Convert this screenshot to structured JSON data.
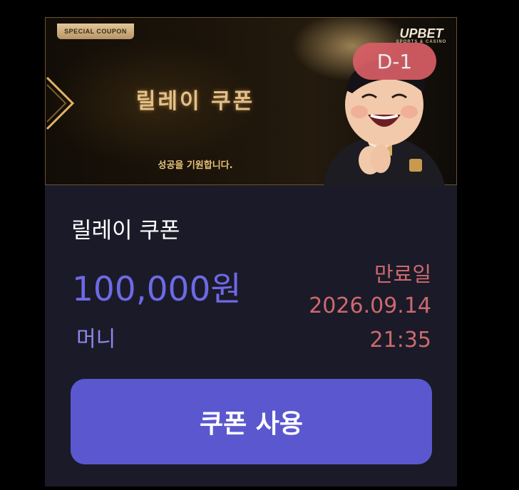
{
  "banner": {
    "badge": "SPECIAL COUPON",
    "title": "릴레이 쿠폰",
    "subtitle": "성공을 기원합니다.",
    "logo": "UPBET",
    "logo_sub": "SPORTS & CASINO",
    "dday": "D-1"
  },
  "coupon": {
    "title": "릴레이 쿠폰",
    "amount": "100,000원",
    "type": "머니",
    "expiry_label": "만료일",
    "expiry_date": "2026.09.14",
    "expiry_time": "21:35",
    "use_button": "쿠폰 사용"
  },
  "colors": {
    "background": "#000000",
    "card": "#1b1a29",
    "amount": "#6d6ae6",
    "expiry": "#cc6a6c",
    "button": "#5b58cf",
    "dday": "#d85e66"
  }
}
